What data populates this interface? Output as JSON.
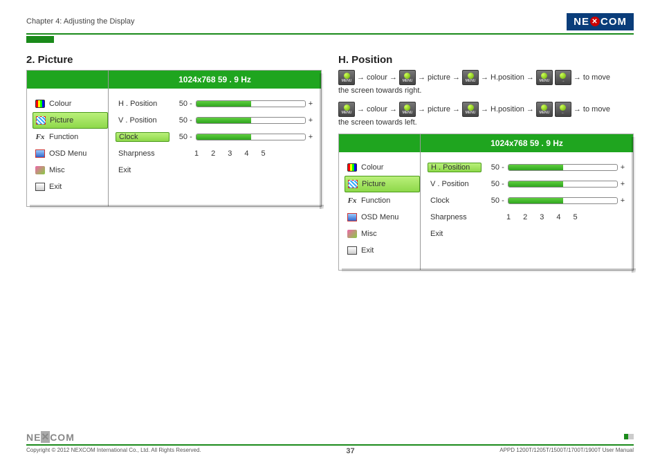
{
  "header": {
    "chapter": "Chapter 4: Adjusting the Display",
    "logo": "NEXCOM"
  },
  "left": {
    "title": "2. Picture",
    "osd": {
      "resolution": "1024x768  59  . 9 Hz",
      "menu": [
        {
          "icon": "colour",
          "label": "Colour"
        },
        {
          "icon": "picture",
          "label": "Picture",
          "sel": true
        },
        {
          "icon": "function",
          "label": "Function"
        },
        {
          "icon": "osd",
          "label": "OSD Menu"
        },
        {
          "icon": "misc",
          "label": "Misc"
        },
        {
          "icon": "exit",
          "label": "Exit"
        }
      ],
      "settings": [
        {
          "label": "H . Position",
          "value": "50",
          "fill": 50
        },
        {
          "label": "V . Position",
          "value": "50",
          "fill": 50
        },
        {
          "label": "Clock",
          "value": "50",
          "fill": 50,
          "sel": true
        }
      ],
      "sharpness_label": "Sharpness",
      "sharpness": [
        "1",
        "2",
        "3",
        "4",
        "5"
      ],
      "exit": "Exit"
    }
  },
  "right": {
    "title": "H. Position",
    "flow1": {
      "steps": [
        {
          "btn": "MENU"
        },
        {
          "txt": "colour"
        },
        {
          "btn": "MENU"
        },
        {
          "txt": "picture"
        },
        {
          "btn": "MENU"
        },
        {
          "txt": "H.position"
        },
        {
          "btn": "MENU"
        },
        {
          "btn": "→"
        },
        {
          "txt": "to move"
        }
      ],
      "desc": "the screen towards right."
    },
    "flow2": {
      "steps": [
        {
          "btn": "MENU"
        },
        {
          "txt": "colour"
        },
        {
          "btn": "MENU"
        },
        {
          "txt": "picture"
        },
        {
          "btn": "MENU"
        },
        {
          "txt": "H.position"
        },
        {
          "btn": "MENU"
        },
        {
          "btn": "←"
        },
        {
          "txt": "to move"
        }
      ],
      "desc": "the screen towards left."
    },
    "osd": {
      "resolution": "1024x768  59  . 9 Hz",
      "menu": [
        {
          "icon": "colour",
          "label": "Colour"
        },
        {
          "icon": "picture",
          "label": "Picture",
          "sel": true
        },
        {
          "icon": "function",
          "label": "Function"
        },
        {
          "icon": "osd",
          "label": "OSD Menu"
        },
        {
          "icon": "misc",
          "label": "Misc"
        },
        {
          "icon": "exit",
          "label": "Exit"
        }
      ],
      "settings": [
        {
          "label": "H . Position",
          "value": "50",
          "fill": 50,
          "sel": true
        },
        {
          "label": "V . Position",
          "value": "50",
          "fill": 50
        },
        {
          "label": "Clock",
          "value": "50",
          "fill": 50
        }
      ],
      "sharpness_label": "Sharpness",
      "sharpness": [
        "1",
        "2",
        "3",
        "4",
        "5"
      ],
      "exit": "Exit"
    }
  },
  "footer": {
    "copyright": "Copyright © 2012 NEXCOM International Co., Ltd. All Rights Reserved.",
    "page": "37",
    "doc": "APPD 1200T/1205T/1500T/1700T/1900T User Manual"
  }
}
